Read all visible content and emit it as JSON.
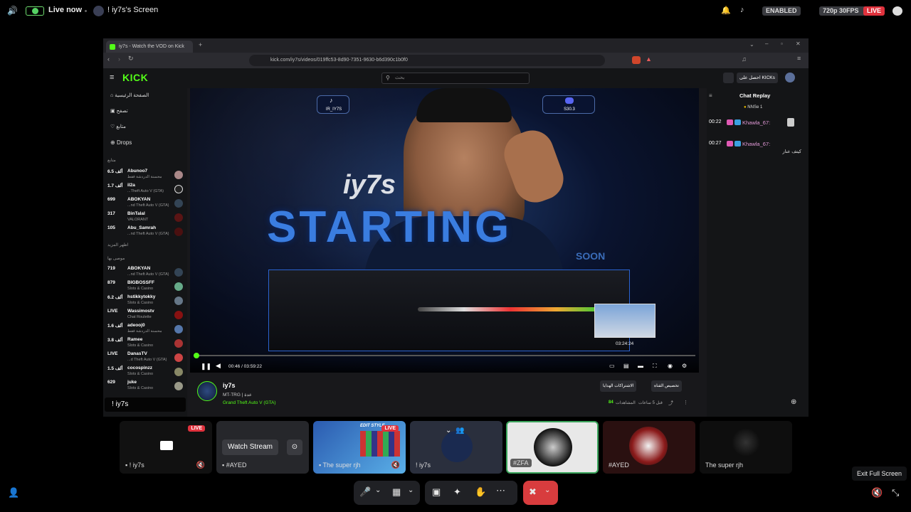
{
  "topbar": {
    "live_now": "Live now",
    "screen_name": "! iy7s's Screen",
    "enabled": "ENABLED",
    "quality": "720p 30FPS",
    "live_badge": "LIVE"
  },
  "browser": {
    "tab_title": "iy7s - Watch the VOD on Kick",
    "url": "kick.com/iy7s/videos/019ffc53-8d90-7351-9630-b6d390c1b0f0"
  },
  "kick": {
    "logo": "KICK",
    "search_placeholder": "بحث",
    "kicks_button": "احصل على KICKs",
    "nav": [
      "الصفحة الرئيسية",
      "تصفح",
      "متابع",
      "Drops"
    ],
    "section_following": "متابع",
    "show_more": "اظهر المزيد",
    "section_recommended": "موصى بها",
    "following": [
      {
        "name": "Abunoo7",
        "viewers": "6.5 ألف",
        "game": "محسنة الدردشة فقط"
      },
      {
        "name": "il2a",
        "viewers": "1.7 ألف",
        "game": "...Theft Auto V (GTA)"
      },
      {
        "name": "ABOKYAN",
        "viewers": "699",
        "game": "...nd Theft Auto V (GTA)"
      },
      {
        "name": "BinTalal",
        "viewers": "317",
        "game": "VALORANT"
      },
      {
        "name": "Abu_Samrah",
        "viewers": "105",
        "game": "...nd Theft Auto V (GTA)"
      }
    ],
    "recommended": [
      {
        "name": "ABOKYAN",
        "viewers": "719",
        "game": "...nd Theft Auto V (GTA)"
      },
      {
        "name": "BIGBOSSFF",
        "viewers": "879",
        "game": "Slots & Casino"
      },
      {
        "name": "hstikkytokky",
        "viewers": "6.2 ألف",
        "game": "Slots & Casino"
      },
      {
        "name": "Wassimostv",
        "viewers": "LIVE",
        "game": "Chat Roulette"
      },
      {
        "name": "adeooj0",
        "viewers": "1.6 ألف",
        "game": "محسنة الدردشة فقط"
      },
      {
        "name": "Ramee",
        "viewers": "3.8 ألف",
        "game": "Slots & Casino"
      },
      {
        "name": "DanasTV",
        "viewers": "LIVE",
        "game": "...d Theft Auto V (GTA)"
      },
      {
        "name": "cocospinzz",
        "viewers": "1.5 ألف",
        "game": "Slots & Casino"
      },
      {
        "name": "juke",
        "viewers": "629",
        "game": "Slots & Casino"
      }
    ],
    "streamer_overlay": "! iy7s"
  },
  "video": {
    "tiktok_handle": "IR_IY7S",
    "discord_handle": "S30.3",
    "watermark": "iy7s",
    "big_text": "STARTING",
    "soon_text": "SOON",
    "time": "00:46 / 03:59:22",
    "preview_time": "03:24:24",
    "progress_fraction": 0.004
  },
  "channel": {
    "name": "iy7s",
    "title": "MT-TRG | عدة",
    "category": "Grand Theft Auto V (GTA)",
    "subscribe_button": "الاشتراكات الهدايا",
    "customize_button": "تخصيص القناة",
    "meta": "قبل 5 ساعات",
    "views_label": "المشاهدات",
    "views": "84"
  },
  "chat": {
    "title": "Chat Replay",
    "badge": "NNSe 1",
    "messages": [
      {
        "time": "00:22",
        "user": "Khawla_67:",
        "text": ""
      },
      {
        "time": "00:27",
        "user": "Khawla_67:",
        "text": "كيتف عنار"
      }
    ]
  },
  "tiles": [
    {
      "label": "! iy7s",
      "live": "LIVE"
    },
    {
      "label": "#AYED",
      "button": "Watch Stream"
    },
    {
      "label": "The super rjh",
      "live": "LIVE",
      "preview_text": "EDIT STYLE"
    },
    {
      "label": "! iy7s"
    },
    {
      "label": "#ZFA"
    },
    {
      "label": "#AYED"
    },
    {
      "label": "The super rjh"
    }
  ],
  "bottom": {
    "tooltip": "Exit Full Screen"
  },
  "colors": {
    "kick_green": "#53fc18",
    "live_red": "#e0323d",
    "discord_blurple": "#5865f2"
  }
}
